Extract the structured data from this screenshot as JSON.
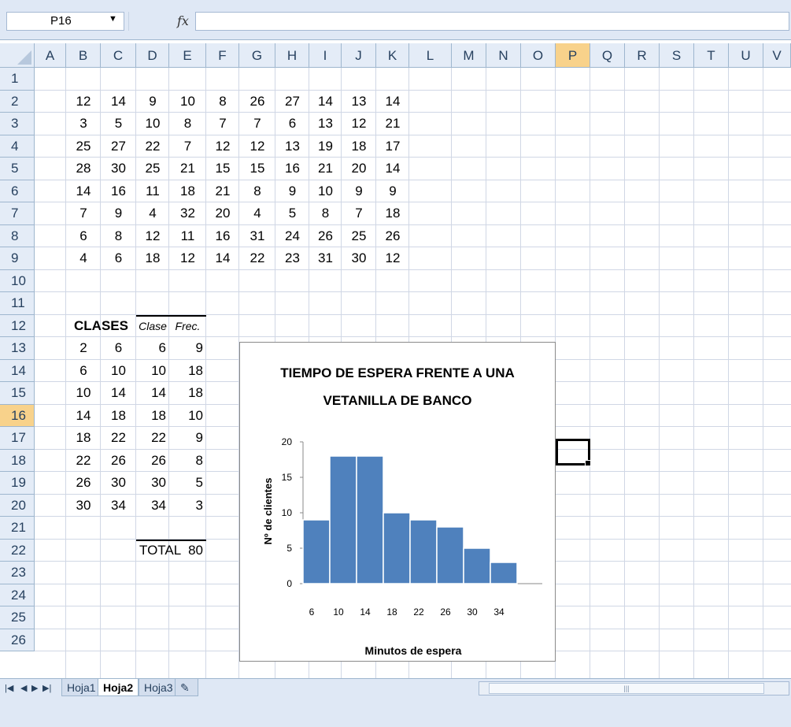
{
  "formula_bar": {
    "name_box": "P16",
    "fx_label": "fx",
    "formula": ""
  },
  "columns": [
    "A",
    "B",
    "C",
    "D",
    "E",
    "F",
    "G",
    "H",
    "I",
    "J",
    "K",
    "L",
    "M",
    "N",
    "O",
    "P",
    "Q",
    "R",
    "S",
    "T",
    "U",
    "V"
  ],
  "rows": [
    "1",
    "2",
    "3",
    "4",
    "5",
    "6",
    "7",
    "8",
    "9",
    "10",
    "11",
    "12",
    "13",
    "14",
    "15",
    "16",
    "17",
    "18",
    "19",
    "20",
    "21",
    "22",
    "23",
    "24",
    "25",
    "26"
  ],
  "selected": {
    "column": "P",
    "row": "16"
  },
  "data_table": [
    [
      "12",
      "14",
      "9",
      "10",
      "8",
      "26",
      "27",
      "14",
      "13",
      "14"
    ],
    [
      "3",
      "5",
      "10",
      "8",
      "7",
      "7",
      "6",
      "13",
      "12",
      "21"
    ],
    [
      "25",
      "27",
      "22",
      "7",
      "12",
      "12",
      "13",
      "19",
      "18",
      "17"
    ],
    [
      "28",
      "30",
      "25",
      "21",
      "15",
      "15",
      "16",
      "21",
      "20",
      "14"
    ],
    [
      "14",
      "16",
      "11",
      "18",
      "21",
      "8",
      "9",
      "10",
      "9",
      "9"
    ],
    [
      "7",
      "9",
      "4",
      "32",
      "20",
      "4",
      "5",
      "8",
      "7",
      "18"
    ],
    [
      "6",
      "8",
      "12",
      "11",
      "16",
      "31",
      "24",
      "26",
      "25",
      "26"
    ],
    [
      "4",
      "6",
      "18",
      "12",
      "14",
      "22",
      "23",
      "31",
      "30",
      "12"
    ]
  ],
  "classes": {
    "title": "CLASES",
    "clase_header": "Clase",
    "frec_header": "Frec.",
    "rows": [
      [
        "2",
        "6",
        "6",
        "9"
      ],
      [
        "6",
        "10",
        "10",
        "18"
      ],
      [
        "10",
        "14",
        "14",
        "18"
      ],
      [
        "14",
        "18",
        "18",
        "10"
      ],
      [
        "18",
        "22",
        "22",
        "9"
      ],
      [
        "22",
        "26",
        "26",
        "8"
      ],
      [
        "26",
        "30",
        "30",
        "5"
      ],
      [
        "30",
        "34",
        "34",
        "3"
      ]
    ],
    "total_label": "TOTAL",
    "total_value": "80"
  },
  "chart_data": {
    "type": "bar",
    "title_line1": "TIEMPO DE ESPERA FRENTE A UNA",
    "title_line2": "VETANILLA DE BANCO",
    "categories": [
      "6",
      "10",
      "14",
      "18",
      "22",
      "26",
      "30",
      "34"
    ],
    "values": [
      9,
      18,
      18,
      10,
      9,
      8,
      5,
      3
    ],
    "xlabel": "Minutos de espera",
    "ylabel": "Nº de clientes",
    "ylim": [
      0,
      20
    ],
    "yticks": [
      "0",
      "5",
      "10",
      "15",
      "20"
    ],
    "bar_color": "#4f81bd",
    "grid": false
  },
  "sheet_tabs": [
    "Hoja1",
    "Hoja2",
    "Hoja3"
  ],
  "active_sheet": "Hoja2",
  "colors": {
    "header_bg": "#e4ecf7",
    "selected_header": "#f8d28b",
    "grid": "#d0d7e5"
  }
}
